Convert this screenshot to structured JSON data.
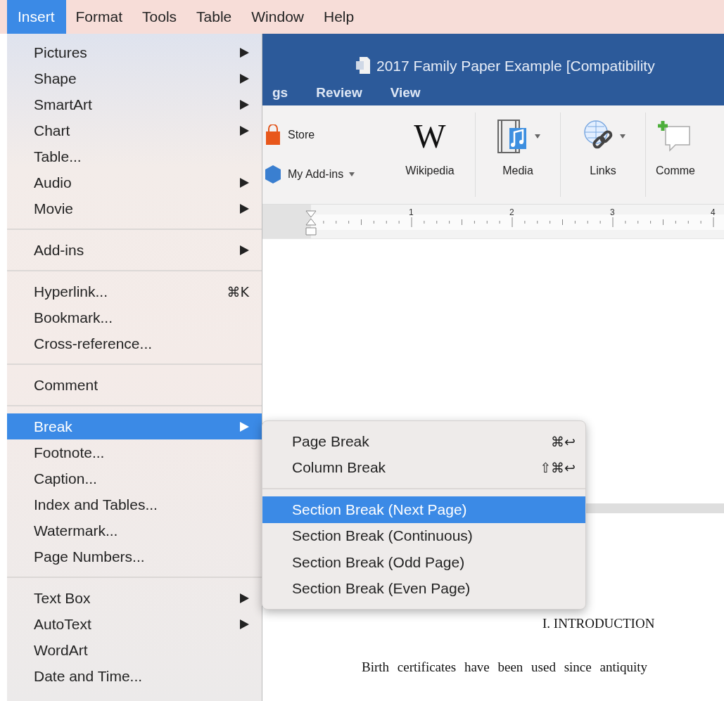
{
  "menubar": {
    "items": [
      {
        "label": "Insert",
        "selected": true
      },
      {
        "label": "Format",
        "selected": false
      },
      {
        "label": "Tools",
        "selected": false
      },
      {
        "label": "Table",
        "selected": false
      },
      {
        "label": "Window",
        "selected": false
      },
      {
        "label": "Help",
        "selected": false
      }
    ]
  },
  "window": {
    "title": "2017 Family Paper Example [Compatibility",
    "tabs": [
      {
        "label": "gs"
      },
      {
        "label": "Review"
      },
      {
        "label": "View"
      }
    ],
    "ribbon": {
      "small_buttons": [
        {
          "kind": "store",
          "label": "Store",
          "dropdown": false
        },
        {
          "kind": "addins",
          "label": "My Add-ins",
          "dropdown": true
        }
      ],
      "large_buttons": [
        {
          "kind": "wikipedia",
          "glyph": "W",
          "label": "Wikipedia",
          "dropdown": false
        },
        {
          "kind": "media",
          "label": "Media",
          "dropdown": true
        },
        {
          "kind": "links",
          "label": "Links",
          "dropdown": true
        },
        {
          "kind": "comment",
          "label": "Comme",
          "dropdown": false
        }
      ]
    },
    "ruler": {
      "numbers": [
        "1",
        "2",
        "3",
        "4"
      ]
    },
    "document": {
      "heading": "I. INTRODUCTION",
      "paragraph": "Birth certificates have been used since antiquity"
    }
  },
  "menu": {
    "items": [
      {
        "kind": "item",
        "label": "Pictures",
        "submenu": true,
        "selected": false
      },
      {
        "kind": "item",
        "label": "Shape",
        "submenu": true,
        "selected": false
      },
      {
        "kind": "item",
        "label": "SmartArt",
        "submenu": true,
        "selected": false
      },
      {
        "kind": "item",
        "label": "Chart",
        "submenu": true,
        "selected": false
      },
      {
        "kind": "item",
        "label": "Table...",
        "submenu": false,
        "selected": false
      },
      {
        "kind": "item",
        "label": "Audio",
        "submenu": true,
        "selected": false
      },
      {
        "kind": "item",
        "label": "Movie",
        "submenu": true,
        "selected": false
      },
      {
        "kind": "separator"
      },
      {
        "kind": "item",
        "label": "Add-ins",
        "submenu": true,
        "selected": false
      },
      {
        "kind": "separator"
      },
      {
        "kind": "item",
        "label": "Hyperlink...",
        "shortcut": "⌘K",
        "submenu": false,
        "selected": false
      },
      {
        "kind": "item",
        "label": "Bookmark...",
        "submenu": false,
        "selected": false
      },
      {
        "kind": "item",
        "label": "Cross-reference...",
        "submenu": false,
        "selected": false
      },
      {
        "kind": "separator"
      },
      {
        "kind": "item",
        "label": "Comment",
        "submenu": false,
        "selected": false
      },
      {
        "kind": "separator"
      },
      {
        "kind": "item",
        "label": "Break",
        "submenu": true,
        "selected": true
      },
      {
        "kind": "item",
        "label": "Footnote...",
        "submenu": false,
        "selected": false
      },
      {
        "kind": "item",
        "label": "Caption...",
        "submenu": false,
        "selected": false
      },
      {
        "kind": "item",
        "label": "Index and Tables...",
        "submenu": false,
        "selected": false
      },
      {
        "kind": "item",
        "label": "Watermark...",
        "submenu": false,
        "selected": false
      },
      {
        "kind": "item",
        "label": "Page Numbers...",
        "submenu": false,
        "selected": false
      },
      {
        "kind": "separator"
      },
      {
        "kind": "item",
        "label": "Text Box",
        "submenu": true,
        "selected": false
      },
      {
        "kind": "item",
        "label": "AutoText",
        "submenu": true,
        "selected": false
      },
      {
        "kind": "item",
        "label": "WordArt",
        "submenu": false,
        "selected": false
      },
      {
        "kind": "item",
        "label": "Date and Time...",
        "submenu": false,
        "selected": false
      }
    ]
  },
  "submenu": {
    "items": [
      {
        "kind": "item",
        "label": "Page Break",
        "shortcut": "⌘↩",
        "selected": false
      },
      {
        "kind": "item",
        "label": "Column Break",
        "shortcut": "⇧⌘↩",
        "selected": false
      },
      {
        "kind": "separator"
      },
      {
        "kind": "item",
        "label": "Section Break (Next Page)",
        "selected": true
      },
      {
        "kind": "item",
        "label": "Section Break (Continuous)",
        "selected": false
      },
      {
        "kind": "item",
        "label": "Section Break (Odd Page)",
        "selected": false
      },
      {
        "kind": "item",
        "label": "Section Break (Even Page)",
        "selected": false
      }
    ]
  }
}
